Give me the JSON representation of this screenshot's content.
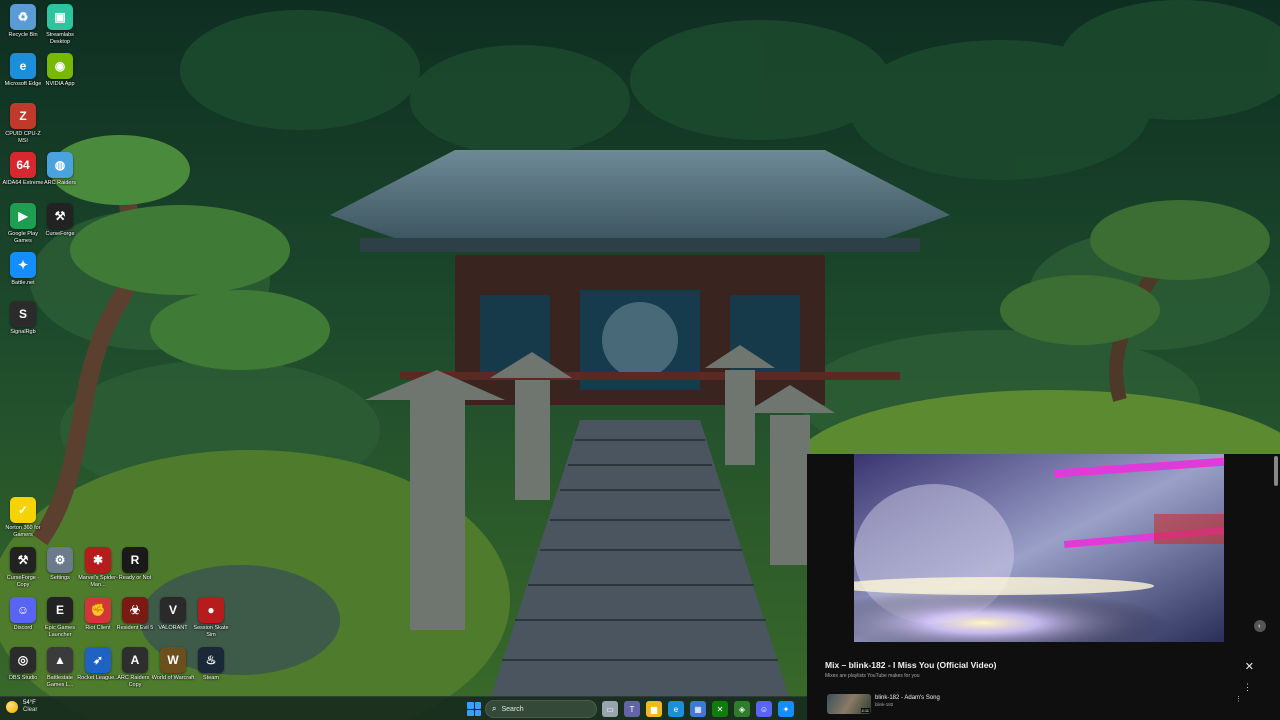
{
  "desktop": {
    "icons": [
      {
        "label": "Recycle Bin",
        "icon": "recycle-bin-icon",
        "color": "#5b9bd5"
      },
      {
        "label": "Streamlabs Desktop",
        "icon": "streamlabs-icon",
        "color": "#2ec4a0"
      },
      {
        "label": "Microsoft Edge",
        "icon": "edge-icon",
        "color": "#1b8fd9"
      },
      {
        "label": "NVIDIA App",
        "icon": "nvidia-icon",
        "color": "#76b900"
      },
      {
        "label": "CPUID CPU-Z MSI",
        "icon": "cpuz-icon",
        "color": "#c0392b"
      },
      {
        "label": "AIDA64 Extreme",
        "icon": "aida64-icon",
        "color": "#d8282f"
      },
      {
        "label": "ARC Raiders",
        "icon": "globe-icon",
        "color": "#4aa3df"
      },
      {
        "label": "Google Play Games",
        "icon": "google-play-icon",
        "color": "#1e9e52"
      },
      {
        "label": "CurseForge",
        "icon": "curseforge-icon",
        "color": "#222222"
      },
      {
        "label": "Battle.net",
        "icon": "battlenet-icon",
        "color": "#148eff"
      },
      {
        "label": "SignalRgb",
        "icon": "signalrgb-icon",
        "color": "#2b2b2b"
      },
      {
        "label": "Norton 360 for Gamers",
        "icon": "norton-icon",
        "color": "#f5d300"
      },
      {
        "label": "CurseForge - Copy",
        "icon": "curseforge-icon",
        "color": "#222222"
      },
      {
        "label": "Settings",
        "icon": "gear-icon",
        "color": "#6b7b8c"
      },
      {
        "label": "Marvel's Spider-Man...",
        "icon": "spiderman-icon",
        "color": "#b71c1c"
      },
      {
        "label": "Ready or Not",
        "icon": "ready-or-not-icon",
        "color": "#1a1a1a"
      },
      {
        "label": "Discord",
        "icon": "discord-icon",
        "color": "#5865f2"
      },
      {
        "label": "Epic Games Launcher",
        "icon": "epic-icon",
        "color": "#222222"
      },
      {
        "label": "Riot Client",
        "icon": "riot-icon",
        "color": "#d13639"
      },
      {
        "label": "Resident Evil 5",
        "icon": "resident-evil-icon",
        "color": "#7a1a12"
      },
      {
        "label": "VALORANT",
        "icon": "valorant-icon",
        "color": "#2a2a2a"
      },
      {
        "label": "Session Skate Sim",
        "icon": "session-icon",
        "color": "#b71c1c"
      },
      {
        "label": "OBS Studio",
        "icon": "obs-icon",
        "color": "#2b2b2b"
      },
      {
        "label": "Battlestate Games L...",
        "icon": "battlestate-icon",
        "color": "#3b3b3b"
      },
      {
        "label": "Rocket League...",
        "icon": "rocket-league-icon",
        "color": "#1e63c4"
      },
      {
        "label": "ARC Raiders - Copy",
        "icon": "arc-raiders-icon",
        "color": "#2e2e2e"
      },
      {
        "label": "World of Warcraft",
        "icon": "wow-icon",
        "color": "#6b4f1d"
      },
      {
        "label": "Steam",
        "icon": "steam-icon",
        "color": "#1b2838"
      }
    ]
  },
  "player": {
    "title": "Mix – blink-182 - I Miss You (Official Video)",
    "subtitle": "Mixes are playlists YouTube makes for you",
    "close_glyph": "✕",
    "more_glyph": "⋮",
    "queue": {
      "title": "blink-182 - Adam's Song",
      "channel": "blink-182",
      "duration": "4:11"
    }
  },
  "taskbar": {
    "weather_temp": "54°F",
    "weather_condition": "Clear",
    "search_label": "Search",
    "apps": [
      {
        "icon": "task-view-icon",
        "color": "#9aa4ae"
      },
      {
        "icon": "teams-icon",
        "color": "#6264a7"
      },
      {
        "icon": "file-explorer-icon",
        "color": "#f2b822"
      },
      {
        "icon": "edge-icon",
        "color": "#1b8fd9"
      },
      {
        "icon": "store-icon",
        "color": "#3e7ad3"
      },
      {
        "icon": "xbox-icon",
        "color": "#107c10"
      },
      {
        "icon": "xbox-game-bar-icon",
        "color": "#2d7d2d"
      },
      {
        "icon": "discord-icon",
        "color": "#5865f2"
      },
      {
        "icon": "battlenet-icon",
        "color": "#148eff"
      }
    ]
  }
}
